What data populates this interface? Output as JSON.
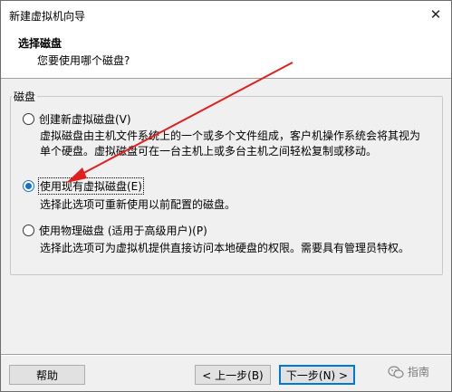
{
  "window": {
    "title": "新建虚拟机向导",
    "close_glyph": "✕"
  },
  "header": {
    "title": "选择磁盘",
    "subtitle": "您要使用哪个磁盘?"
  },
  "group": {
    "legend": "磁盘",
    "options": [
      {
        "label": "创建新虚拟磁盘(V)",
        "checked": false,
        "desc": [
          "虚拟磁盘由主机文件系统上的一个或多个文件组成，客户机操作系统会将其视为",
          "单个硬盘。虚拟磁盘可在一台主机上或多台主机之间轻松复制或移动。"
        ]
      },
      {
        "label": "使用现有虚拟磁盘(E)",
        "checked": true,
        "desc": [
          "选择此选项可重新使用以前配置的磁盘。"
        ]
      },
      {
        "label": "使用物理磁盘 (适用于高级用户)(P)",
        "checked": false,
        "desc": [
          "选择此选项可为虚拟机提供直接访问本地硬盘的权限。需要具有管理员特权。"
        ]
      }
    ]
  },
  "footer": {
    "help_label": "帮助",
    "back_label": "< 上一步(B)",
    "next_label": "下一步(N) >",
    "watermark_text": "指南"
  },
  "colors": {
    "accent": "#1a6fc8",
    "annotation_arrow": "#e0201f"
  },
  "icons": {
    "close": "close-icon",
    "watermark": "wechat-icon"
  }
}
